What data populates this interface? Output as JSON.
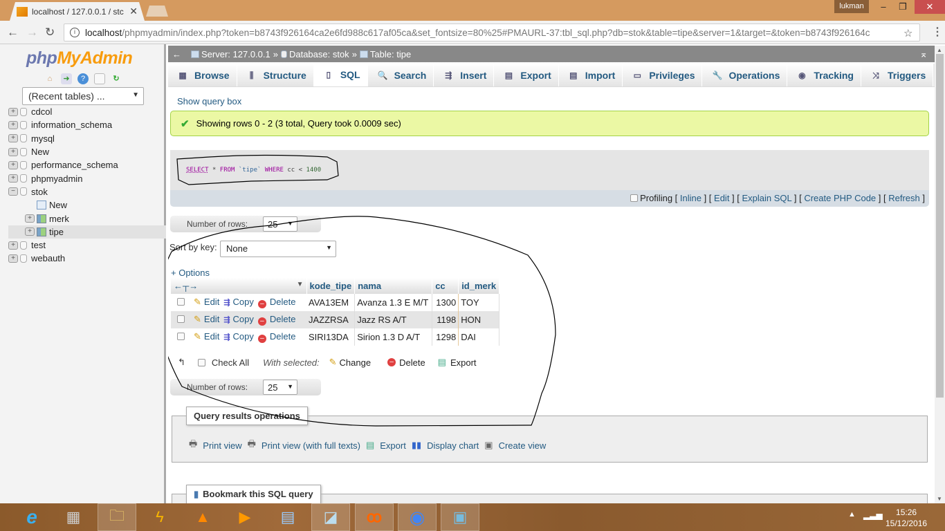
{
  "browser": {
    "tab_title": "localhost / 127.0.0.1 / stc",
    "user_badge": "lukman",
    "url_host": "localhost",
    "url_rest": "/phpmyadmin/index.php?token=b8743f926164ca2e6fd988c617af05ca&set_fontsize=80%25#PMAURL-37:tbl_sql.php?db=stok&table=tipe&server=1&target=&token=b8743f926164c"
  },
  "sidebar": {
    "logo_php": "php",
    "logo_myadmin": "MyAdmin",
    "recent_tables": "(Recent tables) ...",
    "tree": [
      {
        "label": "cdcol",
        "type": "db",
        "expander": "+"
      },
      {
        "label": "information_schema",
        "type": "db",
        "expander": "+"
      },
      {
        "label": "mysql",
        "type": "db",
        "expander": "+"
      },
      {
        "label": "New",
        "type": "new-db",
        "expander": "+"
      },
      {
        "label": "performance_schema",
        "type": "db",
        "expander": "+"
      },
      {
        "label": "phpmyadmin",
        "type": "db",
        "expander": "+"
      },
      {
        "label": "stok",
        "type": "db",
        "expander": "−"
      },
      {
        "label": "New",
        "type": "new-table",
        "expander": ""
      },
      {
        "label": "merk",
        "type": "table",
        "expander": "+"
      },
      {
        "label": "tipe",
        "type": "table",
        "expander": "+",
        "selected": true
      },
      {
        "label": "test",
        "type": "db",
        "expander": "+"
      },
      {
        "label": "webauth",
        "type": "db",
        "expander": "+"
      }
    ]
  },
  "breadcrumb": {
    "server": "Server: 127.0.0.1",
    "database": "Database: stok",
    "table": "Table: tipe",
    "separator": "»"
  },
  "tabs": [
    {
      "label": "Browse",
      "icon": "browse-icon"
    },
    {
      "label": "Structure",
      "icon": "structure-icon"
    },
    {
      "label": "SQL",
      "icon": "sql-icon",
      "active": true
    },
    {
      "label": "Search",
      "icon": "search-icon"
    },
    {
      "label": "Insert",
      "icon": "insert-icon"
    },
    {
      "label": "Export",
      "icon": "export-icon"
    },
    {
      "label": "Import",
      "icon": "import-icon"
    },
    {
      "label": "Privileges",
      "icon": "privileges-icon"
    },
    {
      "label": "Operations",
      "icon": "operations-icon"
    },
    {
      "label": "Tracking",
      "icon": "tracking-icon"
    },
    {
      "label": "Triggers",
      "icon": "triggers-icon"
    }
  ],
  "query": {
    "show_query_box": "Show query box",
    "success_message": "Showing rows 0 - 2 (3 total, Query took 0.0009 sec)",
    "sql_select": "SELECT",
    "sql_star": "*",
    "sql_from": "FROM",
    "sql_table": "`tipe`",
    "sql_where": "WHERE",
    "sql_col": "cc",
    "sql_op": "<",
    "sql_value": "1400",
    "profiling": "Profiling",
    "links": [
      "Inline",
      "Edit",
      "Explain SQL",
      "Create PHP Code",
      "Refresh"
    ]
  },
  "results": {
    "number_of_rows_label": "Number of rows:",
    "number_of_rows_value": "25",
    "sort_by_key_label": "Sort by key:",
    "sort_by_key_value": "None",
    "options_link": "+ Options",
    "columns": [
      "kode_tipe",
      "nama",
      "cc",
      "id_merk"
    ],
    "row_actions": {
      "edit": "Edit",
      "copy": "Copy",
      "delete": "Delete"
    },
    "rows": [
      {
        "kode_tipe": "AVA13EM",
        "nama": "Avanza 1.3 E M/T",
        "cc": "1300",
        "id_merk": "TOY"
      },
      {
        "kode_tipe": "JAZZRSA",
        "nama": "Jazz RS A/T",
        "cc": "1198",
        "id_merk": "HON"
      },
      {
        "kode_tipe": "SIRI13DA",
        "nama": "Sirion 1.3 D A/T",
        "cc": "1298",
        "id_merk": "DAI"
      }
    ],
    "check_all": "Check All",
    "with_selected": "With selected:",
    "bulk_change": "Change",
    "bulk_delete": "Delete",
    "bulk_export": "Export"
  },
  "query_results_operations": {
    "legend": "Query results operations",
    "items": [
      "Print view",
      "Print view (with full texts)",
      "Export",
      "Display chart",
      "Create view"
    ]
  },
  "bookmark": {
    "legend": "Bookmark this SQL query"
  },
  "taskbar": {
    "time": "15:26",
    "date": "15/12/2016"
  }
}
